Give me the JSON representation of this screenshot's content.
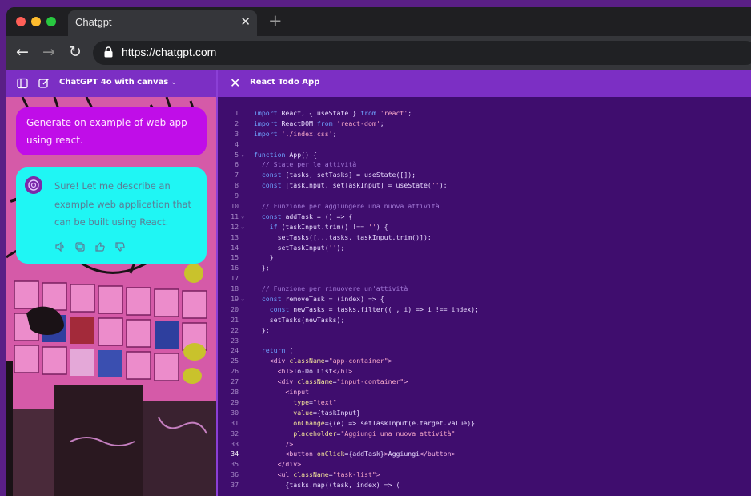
{
  "browser": {
    "tab_title": "Chatgpt",
    "tab_close": "✕",
    "new_tab": "+",
    "url": "https://chatgpt.com"
  },
  "left_panel": {
    "model_label": "ChatGPT 4o with canvas",
    "chevron": "⌄",
    "user_message": "Generate on example of web app using react.",
    "assistant_message": "Sure! Let me describe an example web application that can be built using React.",
    "assistant_actions": [
      "speaker-icon",
      "copy-icon",
      "thumbs-up-icon",
      "thumbs-down-icon"
    ]
  },
  "canvas": {
    "close": "✕",
    "title": "React Todo App",
    "lines": [
      {
        "n": "1",
        "fold": "",
        "html": "<span class='k'>import</span> React, { useState } <span class='k'>from</span> <span class='s'>'react'</span>;"
      },
      {
        "n": "2",
        "fold": "",
        "html": "<span class='k'>import</span> ReactDOM <span class='k'>from</span> <span class='s'>'react-dom'</span>;"
      },
      {
        "n": "3",
        "fold": "",
        "html": "<span class='k'>import</span> <span class='s'>'./index.css'</span>;"
      },
      {
        "n": "4",
        "fold": "",
        "html": ""
      },
      {
        "n": "5",
        "fold": "v",
        "html": "<span class='k'>function</span> App() {"
      },
      {
        "n": "6",
        "fold": "",
        "html": "  <span class='c'>// State per le attività</span>"
      },
      {
        "n": "7",
        "fold": "",
        "html": "  <span class='k'>const</span> [tasks, setTasks] = useState([]);"
      },
      {
        "n": "8",
        "fold": "",
        "html": "  <span class='k'>const</span> [taskInput, setTaskInput] = useState(<span class='s'>''</span>);"
      },
      {
        "n": "9",
        "fold": "",
        "html": ""
      },
      {
        "n": "10",
        "fold": "",
        "html": "  <span class='c'>// Funzione per aggiungere una nuova attività</span>"
      },
      {
        "n": "11",
        "fold": "v",
        "html": "  <span class='k'>const</span> addTask = () => {"
      },
      {
        "n": "12",
        "fold": "v",
        "html": "    <span class='k'>if</span> (taskInput.trim() !== <span class='s'>''</span>) {"
      },
      {
        "n": "13",
        "fold": "",
        "html": "      setTasks([...tasks, taskInput.trim()]);"
      },
      {
        "n": "14",
        "fold": "",
        "html": "      setTaskInput(<span class='s'>''</span>);"
      },
      {
        "n": "15",
        "fold": "",
        "html": "    }"
      },
      {
        "n": "16",
        "fold": "",
        "html": "  };"
      },
      {
        "n": "17",
        "fold": "",
        "html": ""
      },
      {
        "n": "18",
        "fold": "",
        "html": "  <span class='c'>// Funzione per rimuovere un'attività</span>"
      },
      {
        "n": "19",
        "fold": "v",
        "html": "  <span class='k'>const</span> removeTask = (index) => {"
      },
      {
        "n": "20",
        "fold": "",
        "html": "    <span class='k'>const</span> newTasks = tasks.filter((_, i) => i !== index);"
      },
      {
        "n": "21",
        "fold": "",
        "html": "    setTasks(newTasks);"
      },
      {
        "n": "22",
        "fold": "",
        "html": "  };"
      },
      {
        "n": "23",
        "fold": "",
        "html": ""
      },
      {
        "n": "24",
        "fold": "",
        "html": "  <span class='k'>return</span> ("
      },
      {
        "n": "25",
        "fold": "",
        "html": "    <span class='t'>&lt;div</span> <span class='a'>className</span>=<span class='s'>\"app-container\"</span><span class='t'>&gt;</span>"
      },
      {
        "n": "26",
        "fold": "",
        "html": "      <span class='t'>&lt;h1&gt;</span>To-Do List<span class='t'>&lt;/h1&gt;</span>"
      },
      {
        "n": "27",
        "fold": "",
        "html": "      <span class='t'>&lt;div</span> <span class='a'>className</span>=<span class='s'>\"input-container\"</span><span class='t'>&gt;</span>"
      },
      {
        "n": "28",
        "fold": "",
        "html": "        <span class='t'>&lt;input</span>"
      },
      {
        "n": "29",
        "fold": "",
        "html": "          <span class='a'>type</span>=<span class='s'>\"text\"</span>"
      },
      {
        "n": "30",
        "fold": "",
        "html": "          <span class='a'>value</span>={taskInput}"
      },
      {
        "n": "31",
        "fold": "",
        "html": "          <span class='a'>onChange</span>={(e) => setTaskInput(e.target.value)}"
      },
      {
        "n": "32",
        "fold": "",
        "html": "          <span class='a'>placeholder</span>=<span class='s'>\"Aggiungi una nuova attività\"</span>"
      },
      {
        "n": "33",
        "fold": "",
        "html": "        <span class='t'>/&gt;</span>"
      },
      {
        "n": "34",
        "fold": "",
        "html": "        <span class='t'>&lt;button</span> <span class='a'>onClick</span>={addTask}<span class='t'>&gt;</span>Aggiungi<span class='t'>&lt;/button&gt;</span>"
      },
      {
        "n": "35",
        "fold": "",
        "html": "      <span class='t'>&lt;/div&gt;</span>"
      },
      {
        "n": "36",
        "fold": "",
        "html": "      <span class='t'>&lt;ul</span> <span class='a'>className</span>=<span class='s'>\"task-list\"</span><span class='t'>&gt;</span>"
      },
      {
        "n": "37",
        "fold": "",
        "html": "        {tasks.map((task, index) => ("
      }
    ],
    "current_line": "34"
  }
}
